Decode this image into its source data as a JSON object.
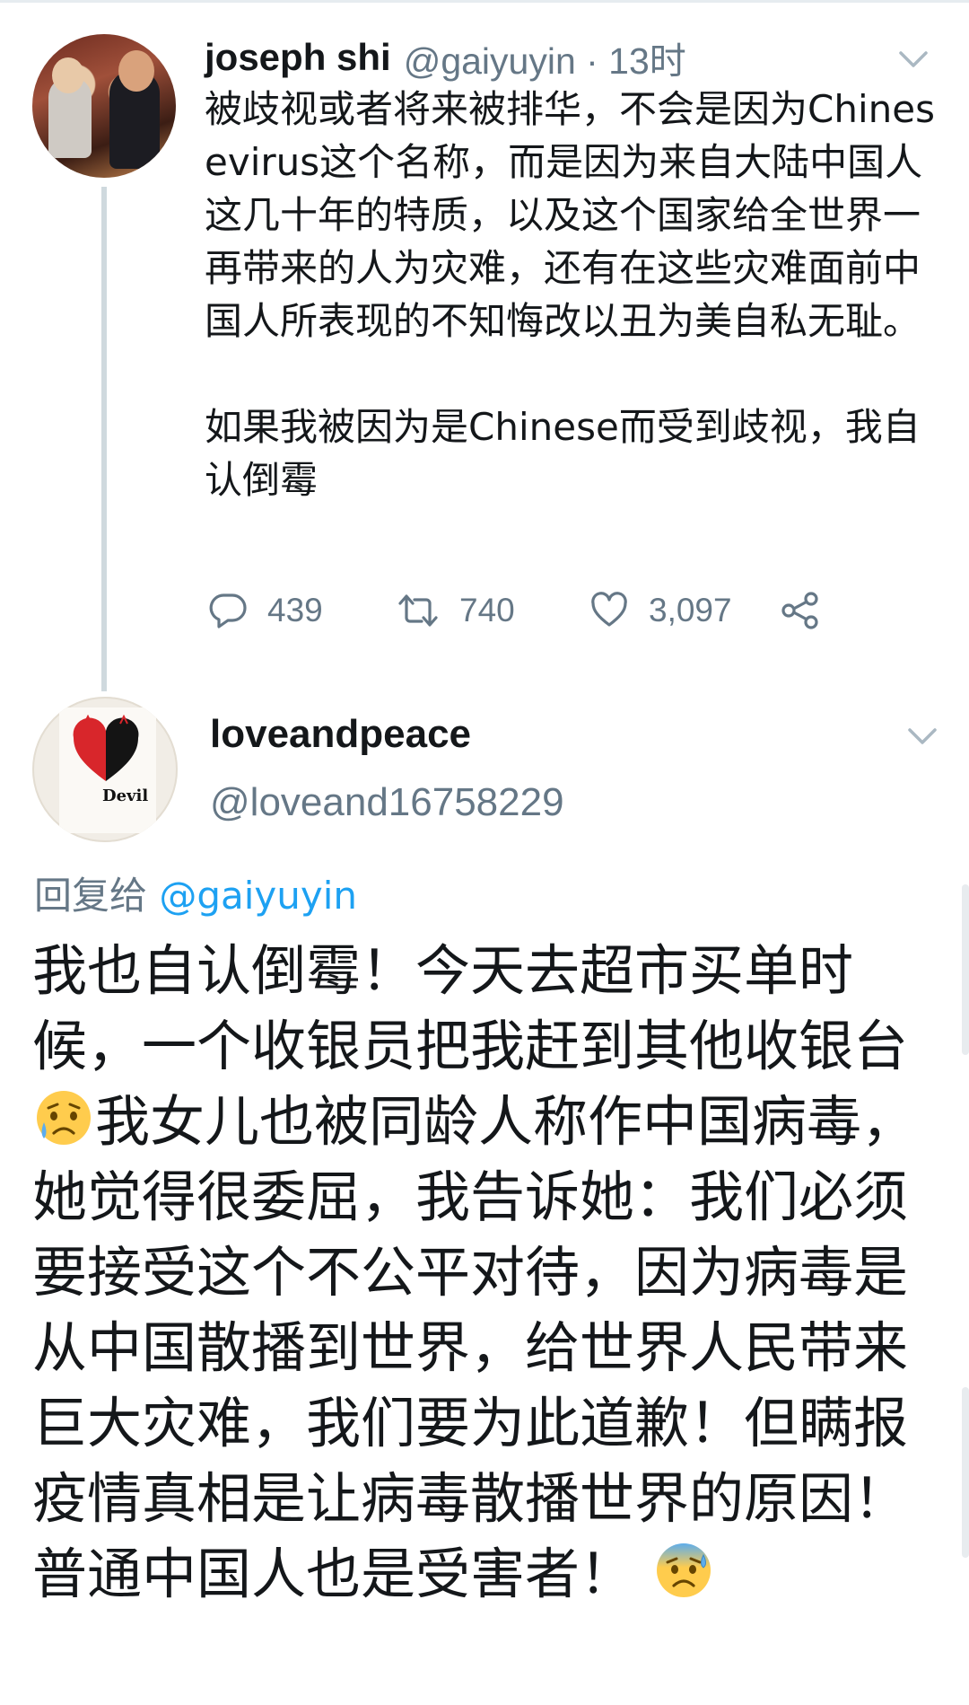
{
  "tweet1": {
    "author_name": "joseph shi",
    "handle_time": "@gaiyuyin · 13时",
    "body": "被歧视或者将来被排华，不会是因为Chinesevirus这个名称，而是因为来自大陆中国人这几十年的特质，以及这个国家给全世界一再带来的人为灾难，还有在这些灾难面前中国人所表现的不知悔改以丑为美自私无耻。\n\n如果我被因为是Chinese而受到歧视，我自认倒霉",
    "replies": "439",
    "retweets": "740",
    "likes": "3,097"
  },
  "tweet2": {
    "author_name": "loveandpeace",
    "handle": "@loveand16758229",
    "reply_prefix": "回复给 ",
    "reply_mention": "@gaiyuyin",
    "body_part1": "我也自认倒霉！今天去超市买单时候，一个收银员把我赶到其他收银台",
    "body_part2": "我女儿也被同龄人称作中国病毒，她觉得很委屈，我告诉她：我们必须要接受这个不公平对待，因为病毒是从中国散播到世界，给世界人民带来巨大灾难，我们要为此道歉！但瞒报疫情真相是让病毒散播世界的原因！普通中国人也是受害者！",
    "avatar_text": "Devil"
  },
  "icons": {
    "reply": "reply-icon",
    "retweet": "retweet-icon",
    "like": "heart-icon",
    "share": "share-icon",
    "more": "chevron-down-icon",
    "emoji1": "disappointed-relieved-emoji",
    "emoji2": "anxious-sweat-emoji"
  },
  "colors": {
    "text": "#14171a",
    "secondary": "#657786",
    "link": "#1da1f2",
    "thread_line": "#cfd9de"
  }
}
